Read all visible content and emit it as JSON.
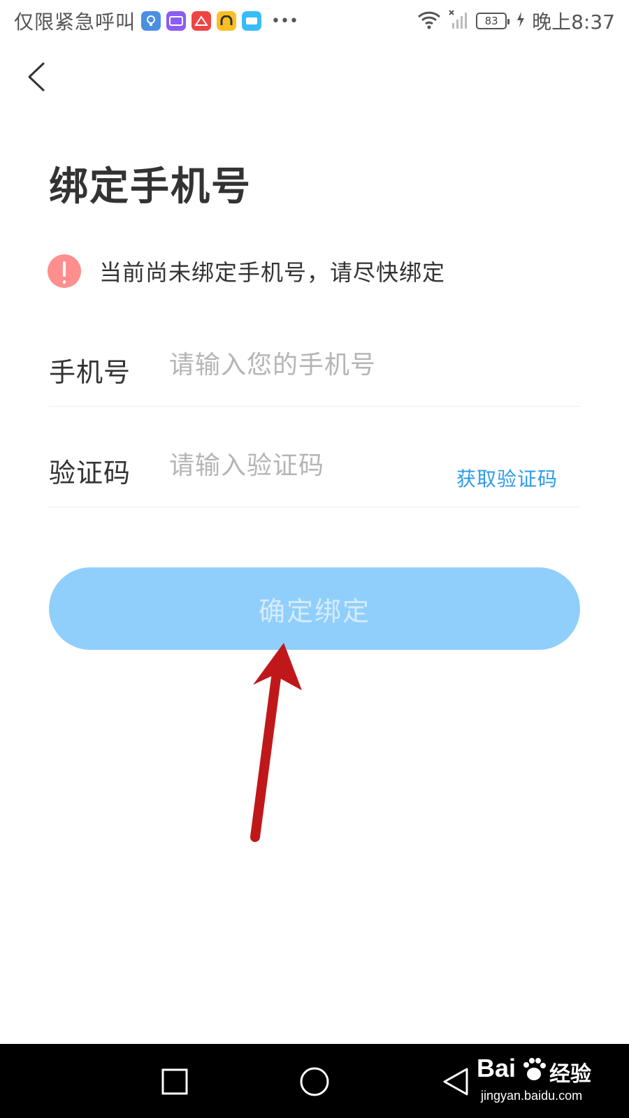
{
  "status_bar": {
    "carrier": "仅限紧急呼叫",
    "battery": "83",
    "time": "晚上8:37",
    "icons": [
      "app-icon-bulb",
      "app-icon-purple",
      "app-icon-qijia",
      "app-icon-yellow",
      "app-icon-xuebao",
      "more-icon",
      "wifi-icon",
      "signal-icon",
      "battery-icon",
      "charging-icon"
    ]
  },
  "header": {
    "back_icon": "chevron-left-icon"
  },
  "main": {
    "title": "绑定手机号",
    "warning": {
      "icon": "alert-icon",
      "text": "当前尚未绑定手机号，请尽快绑定",
      "color": "#ff8f8f"
    },
    "phone": {
      "label": "手机号",
      "placeholder": "请输入您的手机号",
      "value": ""
    },
    "code": {
      "label": "验证码",
      "placeholder": "请输入验证码",
      "value": "",
      "get_code_label": "获取验证码",
      "link_color": "#2b9be8"
    },
    "confirm_button": {
      "label": "确定绑定",
      "background": "#90cffc",
      "enabled": false
    }
  },
  "annotation": {
    "icon": "red-arrow-icon",
    "color": "#c0181a"
  },
  "nav_bar": {
    "icons": [
      "recent-apps-icon",
      "home-icon",
      "back-icon"
    ]
  },
  "watermark": {
    "logo": "Bai",
    "logo_tail": "经验",
    "url": "jingyan.baidu.com"
  }
}
